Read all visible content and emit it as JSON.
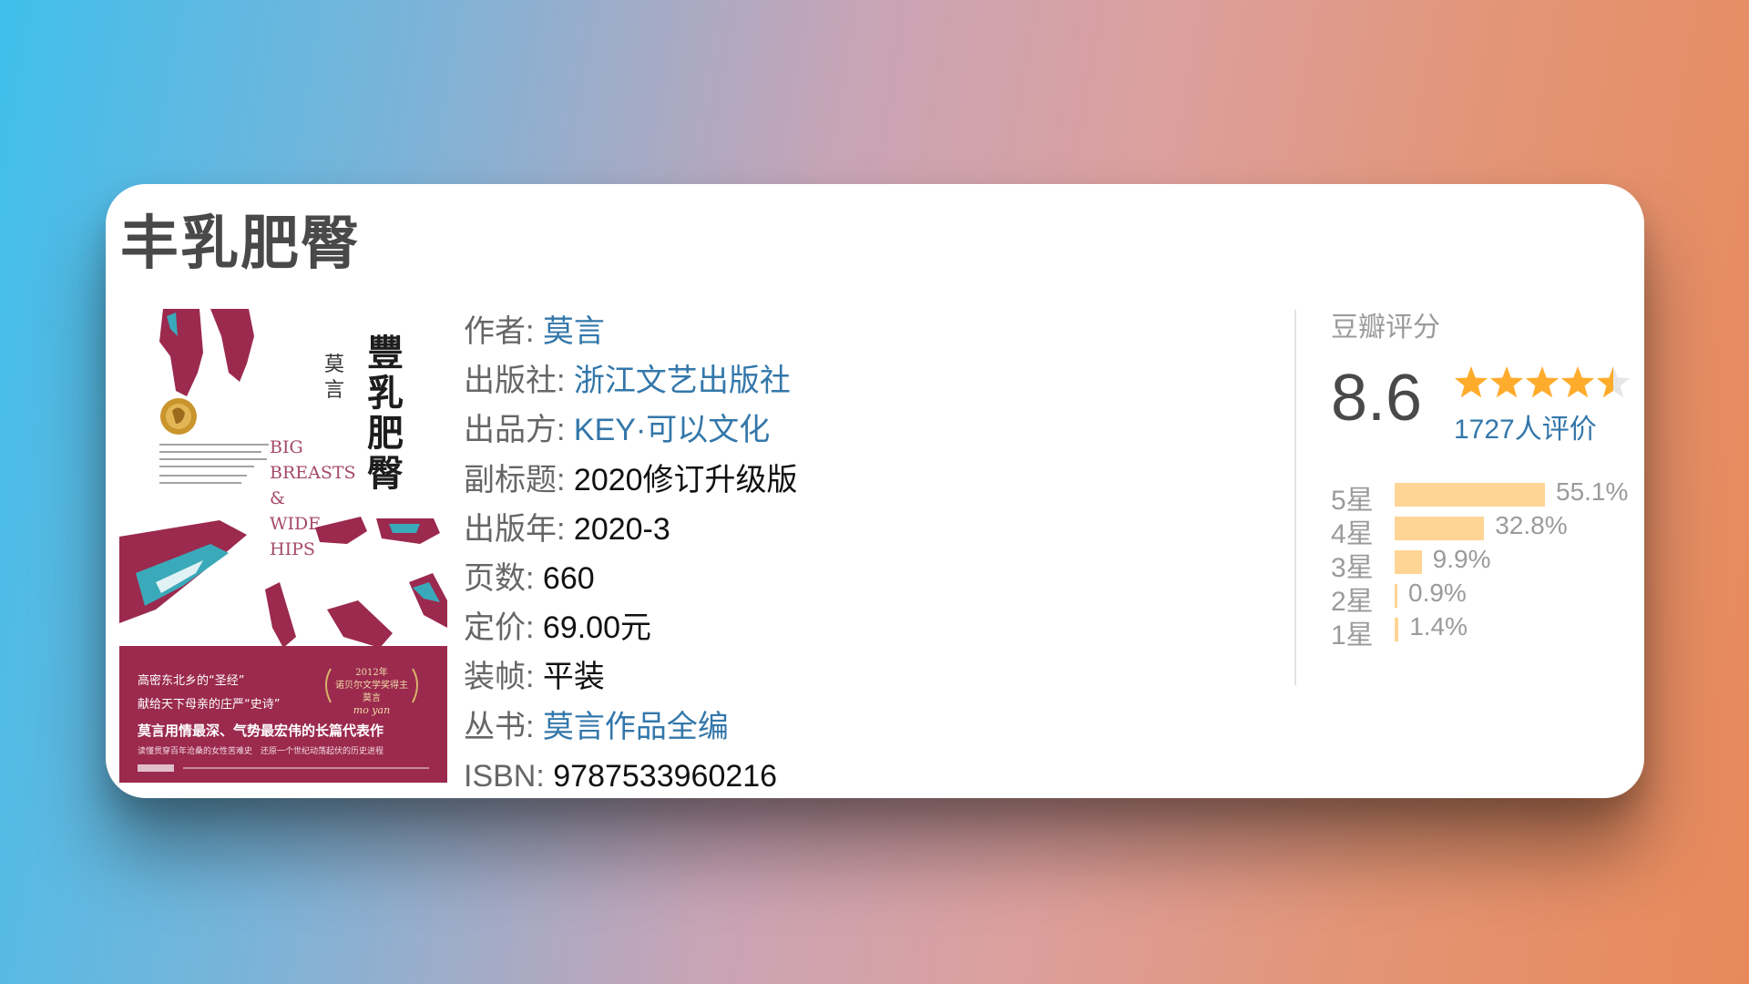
{
  "book": {
    "title": "丰乳肥臀",
    "info": [
      {
        "label": "作者",
        "value": "莫言",
        "link": true
      },
      {
        "label": "出版社",
        "value": "浙江文艺出版社",
        "link": true
      },
      {
        "label": "出品方",
        "value": "KEY·可以文化",
        "link": true
      },
      {
        "label": "副标题",
        "value": "2020修订升级版",
        "link": false
      },
      {
        "label": "出版年",
        "value": "2020-3",
        "link": false
      },
      {
        "label": "页数",
        "value": "660",
        "link": false
      },
      {
        "label": "定价",
        "value": "69.00元",
        "link": false
      },
      {
        "label": "装帧",
        "value": "平装",
        "link": false
      },
      {
        "label": "丛书",
        "value": "莫言作品全编",
        "link": true
      },
      {
        "label": "ISBN",
        "value": "9787533960216",
        "link": false
      }
    ]
  },
  "cover": {
    "author": "莫言",
    "title_calligraphy": "豐乳肥臀",
    "english_title": [
      "BIG",
      "BREASTS",
      "&",
      "WIDE",
      "HIPS"
    ],
    "tagline1": "高密东北乡的“圣经”",
    "tagline2": "献给天下母亲的庄严“史诗”",
    "headline": "莫言用情最深、气势最宏伟的长篇代表作",
    "subline": "读懂贯穿百年沧桑的女性苦难史　还原一个世纪动荡起伏的历史进程",
    "award_year": "2012年",
    "award_line": "诺贝尔文学奖得主",
    "award_name": "莫言",
    "award_signature": "mo yan"
  },
  "rating": {
    "label": "豆瓣评分",
    "score": "8.6",
    "stars_value": 4.5,
    "stars_max": 5,
    "votes": "1727人评价",
    "distribution": [
      {
        "label": "5星",
        "percent": "55.1%",
        "value": 55.1
      },
      {
        "label": "4星",
        "percent": "32.8%",
        "value": 32.8
      },
      {
        "label": "3星",
        "percent": "9.9%",
        "value": 9.9
      },
      {
        "label": "2星",
        "percent": "0.9%",
        "value": 0.9
      },
      {
        "label": "1星",
        "percent": "1.4%",
        "value": 1.4
      }
    ]
  },
  "colors": {
    "link": "#3377aa",
    "bar": "#ffd596",
    "star": "#ffac2d",
    "cover_crimson": "#9b2a4e",
    "cover_teal": "#3aa9b9"
  }
}
